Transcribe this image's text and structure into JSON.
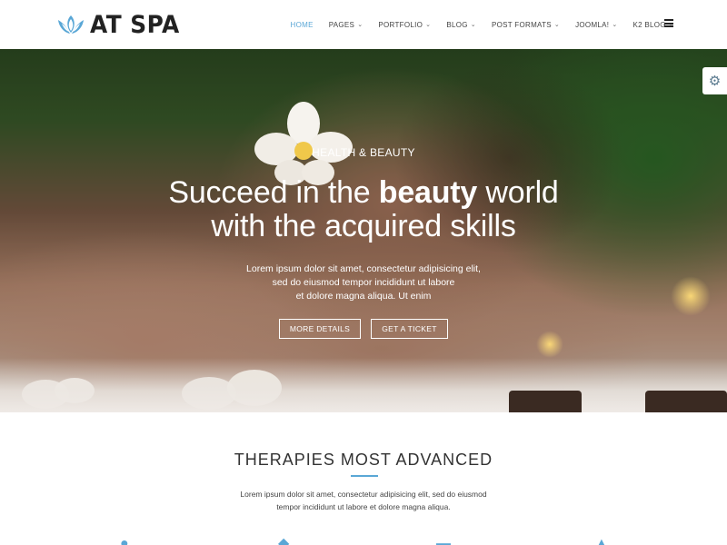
{
  "header": {
    "logo_text": "AT SPA",
    "logo_icon": "lotus-icon",
    "nav": [
      {
        "label": "HOME",
        "active": true,
        "dropdown": false
      },
      {
        "label": "PAGES",
        "active": false,
        "dropdown": true
      },
      {
        "label": "PORTFOLIO",
        "active": false,
        "dropdown": true
      },
      {
        "label": "BLOG",
        "active": false,
        "dropdown": true
      },
      {
        "label": "POST FORMATS",
        "active": false,
        "dropdown": true
      },
      {
        "label": "JOOMLA!",
        "active": false,
        "dropdown": true
      },
      {
        "label": "K2 BLOG",
        "active": false,
        "dropdown": true
      }
    ],
    "menu_icon": "hamburger-icon"
  },
  "hero": {
    "eyebrow": "HEALTH & BEAUTY",
    "headline_line1_pre": "Succeed in the ",
    "headline_line1_bold": "beauty",
    "headline_line1_post": " world",
    "headline_line2": "with the acquired skills",
    "desc_line1": "Lorem ipsum dolor sit amet, consectetur adipisicing elit,",
    "desc_line2": "sed do eiusmod tempor incididunt ut labore",
    "desc_line3": "et dolore magna aliqua. Ut enim",
    "button_more": "MORE DETAILS",
    "button_ticket": "GET A TICKET"
  },
  "settings": {
    "icon": "gear-icon"
  },
  "section": {
    "title": "THERAPIES MOST ADVANCED",
    "desc_line1": "Lorem ipsum dolor sit amet, consectetur adipisicing elit, sed do eiusmod",
    "desc_line2": "tempor incididunt ut labore et dolore magna aliqua."
  },
  "colors": {
    "accent": "#5aa7d6",
    "text_dark": "#222222",
    "nav_text": "#444444"
  }
}
